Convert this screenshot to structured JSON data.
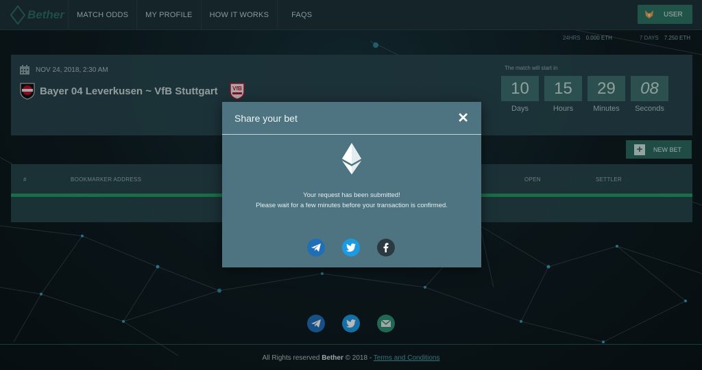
{
  "app": {
    "name": "Bether"
  },
  "nav": {
    "items": [
      {
        "label": "MATCH ODDS"
      },
      {
        "label": "MY PROFILE"
      },
      {
        "label": "HOW IT WORKS"
      },
      {
        "label": "FAQS"
      }
    ],
    "user_button": "USER"
  },
  "stats": {
    "h24_label": "24HRS",
    "h24_value": "0.000 ETH",
    "d7_label": "7 DAYS",
    "d7_value": "7.250 ETH"
  },
  "match": {
    "date": "NOV 24, 2018, 2:30 AM",
    "teams": "Bayer 04 Leverkusen ~ VfB Stuttgart",
    "starts_label": "The match will start in",
    "countdown": [
      {
        "value": "10",
        "label": "Days"
      },
      {
        "value": "15",
        "label": "Hours"
      },
      {
        "value": "29",
        "label": "Minutes"
      },
      {
        "value": "08",
        "label": "Seconds"
      }
    ]
  },
  "new_bet_label": "NEW BET",
  "table": {
    "headers": {
      "num": "#",
      "address": "BOOKMARKER ADDRESS",
      "open": "OPEN",
      "settler": "SETTLER"
    }
  },
  "modal": {
    "title": "Share your bet",
    "close_symbol": "✕",
    "message_line1": "Your request has been submitted!",
    "message_line2": "Please wait for a few minutes before your transaction is confirmed.",
    "share_icons": [
      "telegram-icon",
      "twitter-icon",
      "facebook-icon"
    ]
  },
  "footer": {
    "prefix": "All Rights reserved",
    "brand": "Bether",
    "year": "© 2018 -",
    "terms": "Terms and Conditions",
    "icons": [
      "telegram-icon",
      "twitter-icon",
      "email-icon"
    ]
  },
  "colors": {
    "navbar": "#1c3338",
    "card": "#284850",
    "accent_green": "#26a36a",
    "button": "#2e7566",
    "modal": "#4d7480",
    "telegram": "#1f6fb8",
    "twitter": "#1c9be3",
    "facebook": "#2b3a40"
  }
}
